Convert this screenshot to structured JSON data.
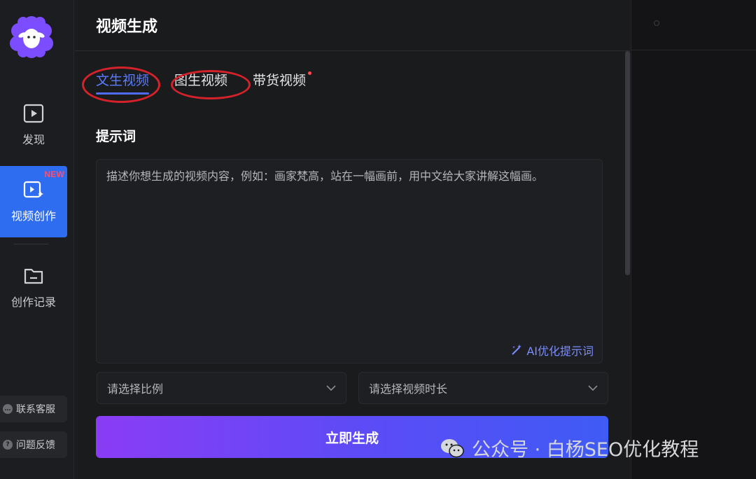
{
  "rail": {
    "items": [
      {
        "label": "发现",
        "icon": "play-icon"
      },
      {
        "label": "视频创作",
        "icon": "video-create-icon",
        "badge": "NEW",
        "active": true
      },
      {
        "label": "创作记录",
        "icon": "folder-icon"
      }
    ],
    "contact": "联系客服",
    "feedback": "问题反馈"
  },
  "header": {
    "title": "视频生成"
  },
  "tabs": [
    {
      "label": "文生视频",
      "active": true
    },
    {
      "label": "图生视频"
    },
    {
      "label": "带货视频",
      "dot": true
    }
  ],
  "prompt": {
    "title": "提示词",
    "placeholder": "描述你想生成的视频内容，例如：画家梵高，站在一幅画前，用中文给大家讲解这幅画。",
    "ai_optimize": "AI优化提示词"
  },
  "selects": {
    "ratio_placeholder": "请选择比例",
    "duration_placeholder": "请选择视频时长"
  },
  "generate_label": "立即生成",
  "watermark": "公众号 · 白杨SEO优化教程",
  "colors": {
    "accent": "#2f6df0",
    "tab_active": "#5b7cff",
    "annotation_red": "#d4222a",
    "new_badge": "#ff4d6d"
  }
}
